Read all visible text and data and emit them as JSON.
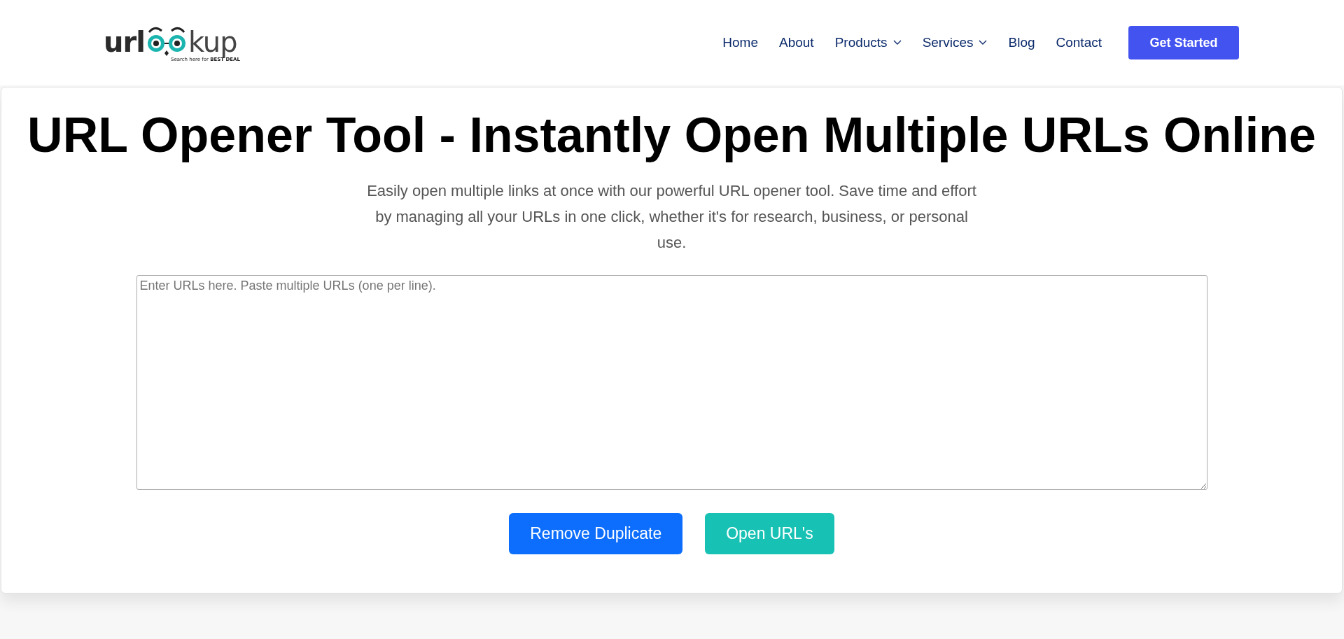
{
  "logo": {
    "text_start": "url",
    "text_end": "kup",
    "tagline": "Search here for **BEST DEAL**"
  },
  "nav": [
    {
      "label": "Home",
      "has_dropdown": false
    },
    {
      "label": "About",
      "has_dropdown": false
    },
    {
      "label": "Products",
      "has_dropdown": true
    },
    {
      "label": "Services",
      "has_dropdown": true
    },
    {
      "label": "Blog",
      "has_dropdown": false
    },
    {
      "label": "Contact",
      "has_dropdown": false
    }
  ],
  "cta": "Get Started",
  "title": "URL Opener Tool - Instantly Open Multiple URLs Online",
  "subtitle": "Easily open multiple links at once with our powerful URL opener tool. Save time and effort by managing all your URLs in one click, whether it's for research, business, or personal use.",
  "url_field": {
    "placeholder": "Enter URLs here. Paste multiple URLs (one per line)."
  },
  "buttons": [
    {
      "label": "Remove Duplicate",
      "kind": "primary"
    },
    {
      "label": "Open URL's",
      "kind": "secondary"
    }
  ]
}
